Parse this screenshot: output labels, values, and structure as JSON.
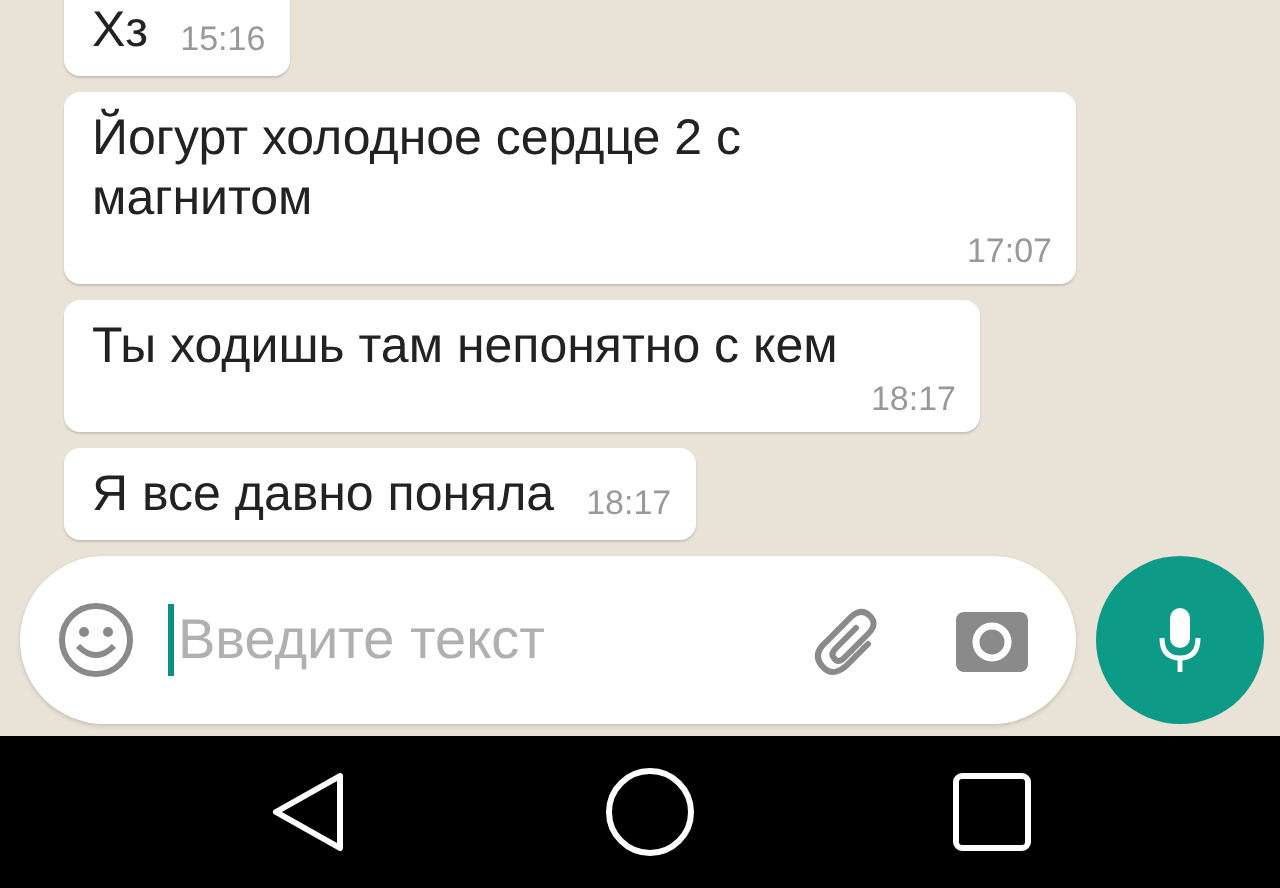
{
  "messages": [
    {
      "text": "Хз",
      "time": "15:16",
      "kind": "inline"
    },
    {
      "text": "Йогурт холодное сердце 2 с магнитом",
      "time": "17:07",
      "kind": "below"
    },
    {
      "text": "Ты ходишь там непонятно с кем",
      "time": "18:17",
      "kind": "below"
    },
    {
      "text": "Я все давно поняла",
      "time": "18:17",
      "kind": "inline"
    }
  ],
  "composer": {
    "placeholder": "Введите текст"
  }
}
